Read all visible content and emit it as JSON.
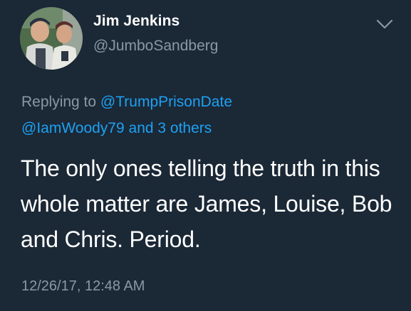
{
  "author": {
    "display_name": "Jim Jenkins",
    "handle": "@JumboSandberg",
    "avatar_icon": "profile-photo"
  },
  "menu": {
    "icon": "chevron-down-icon"
  },
  "reply": {
    "prefix": "Replying to",
    "mention_primary": "@TrumpPrisonDate",
    "mention_secondary": "@IamWoody79",
    "conjunction": "and",
    "others": "3 others"
  },
  "tweet": {
    "text": "The only ones telling the truth in this whole matter are James, Louise, Bob and Chris. Period.",
    "timestamp": "12/26/17, 12:48 AM"
  },
  "colors": {
    "background": "#1b2836",
    "primary_text": "#ffffff",
    "secondary_text": "#8899a6",
    "link": "#1da1f2"
  }
}
